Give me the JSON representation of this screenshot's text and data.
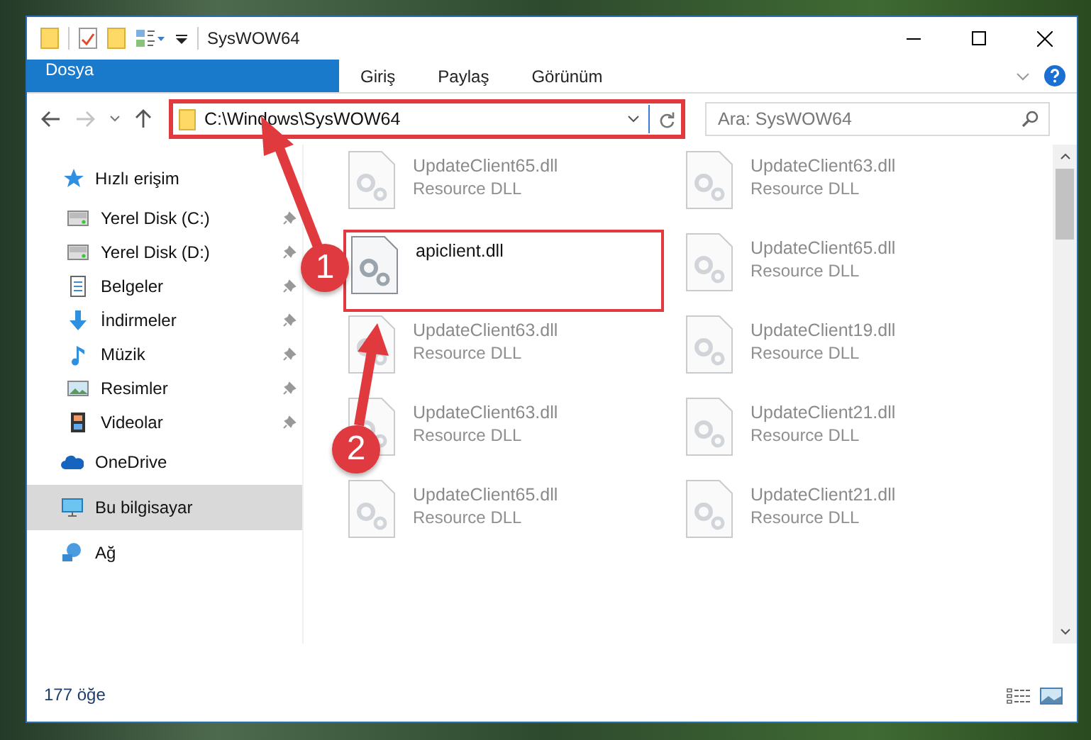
{
  "window": {
    "title": "SysWOW64"
  },
  "tabs": [
    {
      "label": "Dosya",
      "kind": "file",
      "selected": false
    },
    {
      "label": "Giriş",
      "kind": "tab",
      "selected": false
    },
    {
      "label": "Paylaş",
      "kind": "tab",
      "selected": false
    },
    {
      "label": "Görünüm",
      "kind": "tab",
      "selected": false
    }
  ],
  "address": {
    "path": "C:\\Windows\\SysWOW64"
  },
  "search": {
    "placeholder": "Ara: SysWOW64"
  },
  "sidebar": {
    "items": [
      {
        "label": "Hızlı erişim",
        "kind": "star",
        "selected": false,
        "children": [
          {
            "label": "Yerel Disk (C:)",
            "kind": "drive",
            "pinned": true,
            "selected": false
          },
          {
            "label": "Yerel Disk (D:)",
            "kind": "drive",
            "pinned": true,
            "selected": false
          },
          {
            "label": "Belgeler",
            "kind": "document",
            "pinned": true,
            "selected": false
          },
          {
            "label": "İndirmeler",
            "kind": "download",
            "pinned": true,
            "selected": false
          },
          {
            "label": "Müzik",
            "kind": "music",
            "pinned": true,
            "selected": false
          },
          {
            "label": "Resimler",
            "kind": "picture",
            "pinned": true,
            "selected": false
          },
          {
            "label": "Videolar",
            "kind": "video",
            "pinned": true,
            "selected": false
          }
        ]
      },
      {
        "label": "OneDrive",
        "kind": "cloud",
        "selected": false
      },
      {
        "label": "Bu bilgisayar",
        "kind": "computer",
        "selected": true
      },
      {
        "label": "Ağ",
        "kind": "network",
        "selected": false
      }
    ]
  },
  "files": [
    {
      "name": "UpdateClient65.dll",
      "type": "Resource DLL",
      "kind": "blurred"
    },
    {
      "name": "UpdateClient63.dll",
      "type": "Resource DLL",
      "kind": "blurred"
    },
    {
      "name": "apiclient.dll",
      "kind": "highlighted"
    },
    {
      "name": "UpdateClient65.dll",
      "type": "Resource DLL",
      "kind": "blurred"
    },
    {
      "name": "UpdateClient63.dll",
      "type": "Resource DLL",
      "kind": "blurred"
    },
    {
      "name": "UpdateClient19.dll",
      "type": "Resource DLL",
      "kind": "blurred"
    },
    {
      "name": "UpdateClient63.dll",
      "type": "Resource DLL",
      "kind": "blurred"
    },
    {
      "name": "UpdateClient21.dll",
      "type": "Resource DLL",
      "kind": "blurred"
    },
    {
      "name": "UpdateClient65.dll",
      "type": "Resource DLL",
      "kind": "blurred"
    },
    {
      "name": "UpdateClient21.dll",
      "type": "Resource DLL",
      "kind": "blurred"
    }
  ],
  "callouts": [
    {
      "number": "1"
    },
    {
      "number": "2"
    }
  ],
  "status_bar": {
    "item_count": "177 öğe"
  }
}
